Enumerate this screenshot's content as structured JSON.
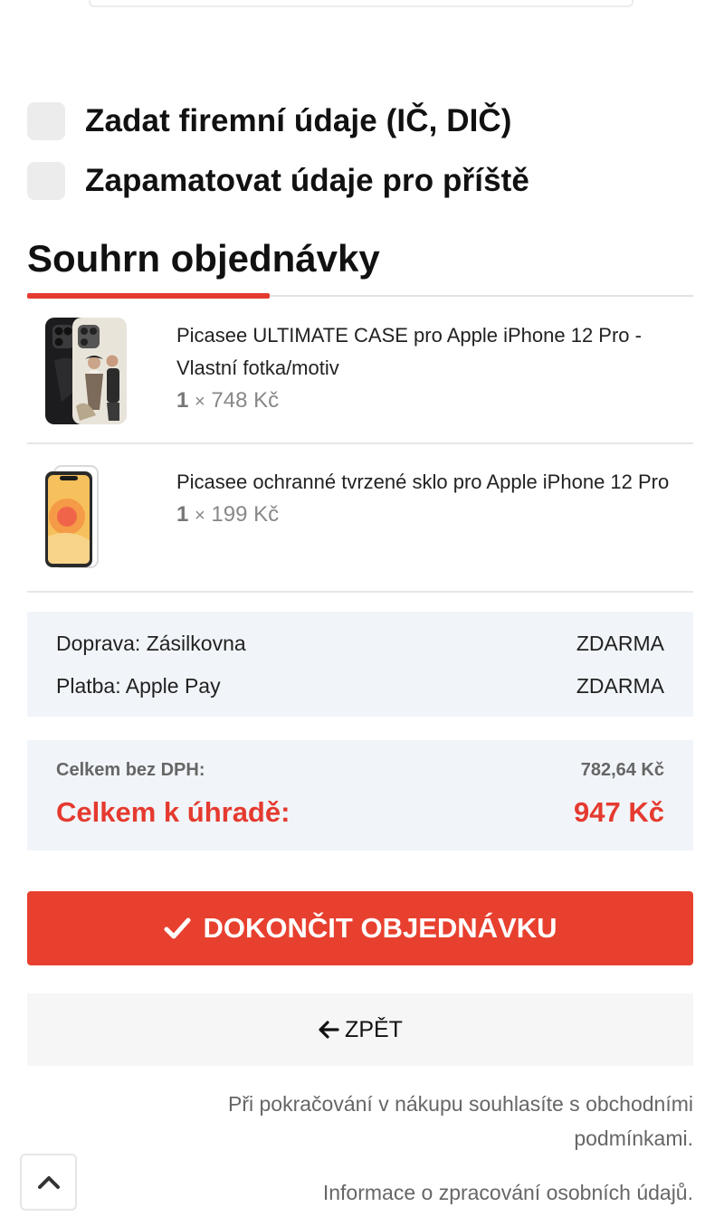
{
  "options": {
    "company_details_label": "Zadat firemní údaje (IČ, DIČ)",
    "remember_details_label": "Zapamatovat údaje pro příště"
  },
  "summary": {
    "title": "Souhrn objednávky",
    "items": [
      {
        "name": "Picasee ULTIMATE CASE pro Apple iPhone 12 Pro - Vlastní fotka/motiv",
        "quantity": "1",
        "times": "×",
        "price": "748 Kč"
      },
      {
        "name": "Picasee ochranné tvrzené sklo pro Apple iPhone 12 Pro",
        "quantity": "1",
        "times": "×",
        "price": "199 Kč"
      }
    ],
    "shipping": {
      "label": "Doprava: Zásilkovna",
      "value": "ZDARMA"
    },
    "payment": {
      "label": "Platba: Apple Pay",
      "value": "ZDARMA"
    },
    "total_without_vat": {
      "label": "Celkem bez DPH:",
      "value": "782,64 Kč"
    },
    "total_to_pay": {
      "label": "Celkem k úhradě:",
      "value": "947 Kč"
    }
  },
  "actions": {
    "finish_label": "DOKONČIT OBJEDNÁVKU",
    "back_label": "ZPĚT"
  },
  "legal": {
    "terms_prefix": "Při pokračování v nákupu souhlasíte s ",
    "terms_link": "obchodními podmínkami",
    "terms_suffix": ".",
    "privacy_prefix": "Informace o ",
    "privacy_link": "zpracování osobních údajů",
    "privacy_suffix": "."
  },
  "colors": {
    "accent": "#e53a2f",
    "panel": "#f1f5f9"
  }
}
